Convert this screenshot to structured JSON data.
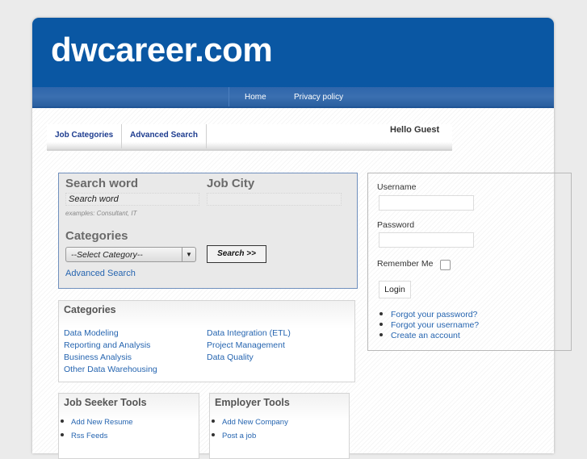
{
  "header": {
    "site_title": "dwcareer.com"
  },
  "nav": {
    "items": [
      {
        "label": "Home"
      },
      {
        "label": "Privacy policy"
      }
    ]
  },
  "tabs": [
    {
      "label": "Job Categories"
    },
    {
      "label": "Advanced Search"
    }
  ],
  "greeting": "Hello Guest",
  "search": {
    "search_word_label": "Search word",
    "search_word_value": "Search word",
    "search_word_hint": "examples: Consultant, IT",
    "job_city_label": "Job City",
    "job_city_value": "",
    "categories_label": "Categories",
    "category_selected": "--Select Category--",
    "search_button": "Search >>",
    "advanced_link": "Advanced Search"
  },
  "categories": {
    "title": "Categories",
    "left": [
      "Data Modeling",
      "Reporting and Analysis",
      "Business Analysis",
      "Other Data Warehousing"
    ],
    "right": [
      "Data Integration (ETL)",
      "Project Management",
      "Data Quality"
    ]
  },
  "job_seeker_tools": {
    "title": "Job Seeker Tools",
    "items": [
      "Add New Resume",
      "Rss Feeds"
    ]
  },
  "employer_tools": {
    "title": "Employer Tools",
    "items": [
      "Add New Company",
      "Post a job"
    ]
  },
  "login": {
    "username_label": "Username",
    "username_value": "",
    "password_label": "Password",
    "password_value": "",
    "remember_label": "Remember Me",
    "remember_checked": false,
    "login_button": "Login",
    "links": [
      "Forgot your password?",
      "Forgot your username?",
      "Create an account"
    ]
  }
}
